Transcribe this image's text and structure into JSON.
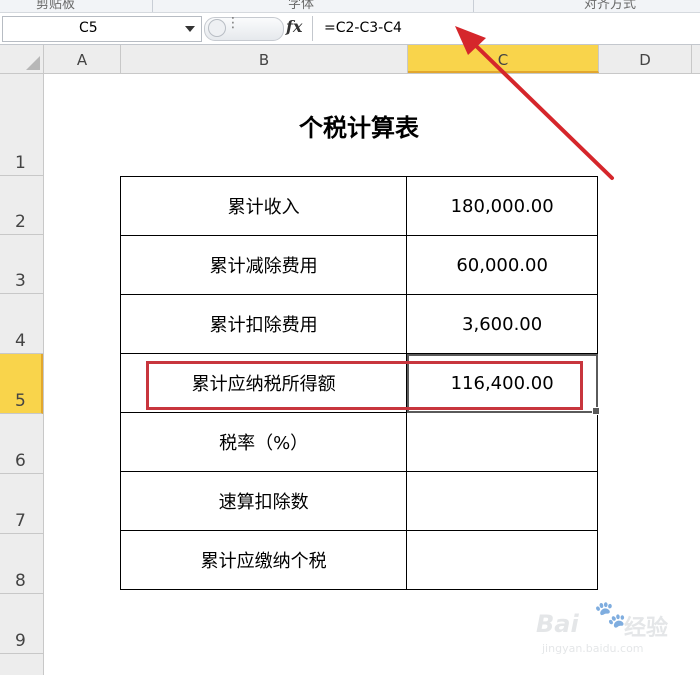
{
  "ribbon": {
    "groups": [
      "剪贴板",
      "字体",
      "对齐方式"
    ]
  },
  "formula_bar": {
    "name_box": "C5",
    "fx_label": "fx",
    "formula": "=C2-C3-C4"
  },
  "columns": [
    "A",
    "B",
    "C",
    "D"
  ],
  "rows": [
    "1",
    "2",
    "3",
    "4",
    "5",
    "6",
    "7",
    "8",
    "9"
  ],
  "selected_cell": {
    "column": "C",
    "row": "5"
  },
  "sheet": {
    "title": "个税计算表",
    "table": [
      {
        "label": "累计收入",
        "value": "180,000.00"
      },
      {
        "label": "累计减除费用",
        "value": "60,000.00"
      },
      {
        "label": "累计扣除费用",
        "value": "3,600.00"
      },
      {
        "label": "累计应纳税所得额",
        "value": "116,400.00"
      },
      {
        "label": "税率（%）",
        "value": ""
      },
      {
        "label": "速算扣除数",
        "value": ""
      },
      {
        "label": "累计应缴纳个税",
        "value": ""
      }
    ]
  },
  "annotation": {
    "highlight_color": "#c8353d",
    "arrow_color": "#d5262b"
  },
  "watermark": {
    "brand": "Bai",
    "paw": "du",
    "product": "经验",
    "url": "jingyan.baidu.com"
  },
  "colors": {
    "selected_header": "#f9d44b",
    "header_bg": "#ededed"
  }
}
